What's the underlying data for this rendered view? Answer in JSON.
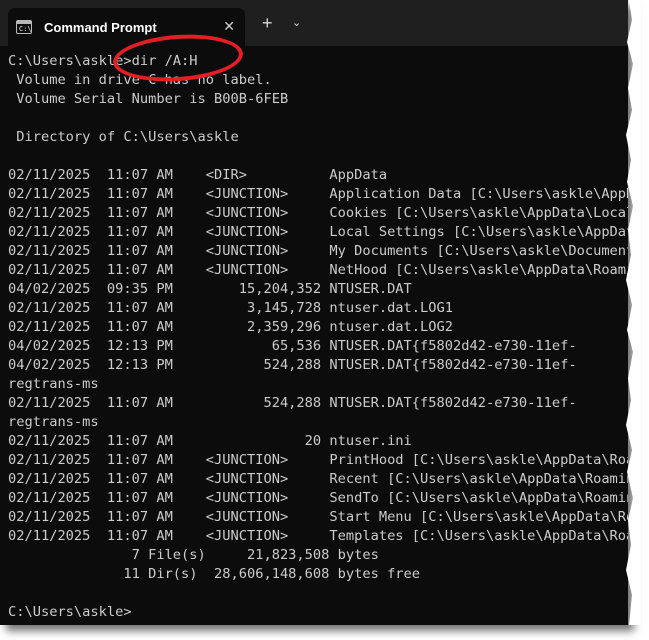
{
  "window": {
    "tab_title": "Command Prompt",
    "tab_icon_glyph": "C:\\",
    "close_glyph": "✕",
    "new_tab_glyph": "+",
    "dropdown_glyph": "⌄"
  },
  "terminal": {
    "lines": [
      "C:\\Users\\askle>dir /A:H",
      " Volume in drive C has no label.",
      " Volume Serial Number is B00B-6FEB",
      "",
      " Directory of C:\\Users\\askle",
      "",
      "02/11/2025  11:07 AM    <DIR>          AppData",
      "02/11/2025  11:07 AM    <JUNCTION>     Application Data [C:\\Users\\askle\\AppData\\Roaming]",
      "02/11/2025  11:07 AM    <JUNCTION>     Cookies [C:\\Users\\askle\\AppData\\Local\\Microsoft\\Windows\\INetCookies]",
      "02/11/2025  11:07 AM    <JUNCTION>     Local Settings [C:\\Users\\askle\\AppData\\Local]",
      "02/11/2025  11:07 AM    <JUNCTION>     My Documents [C:\\Users\\askle\\Documents]",
      "02/11/2025  11:07 AM    <JUNCTION>     NetHood [C:\\Users\\askle\\AppData\\Roaming\\Microsoft\\Windows\\Network Shortcuts]",
      "04/02/2025  09:35 PM        15,204,352 NTUSER.DAT",
      "02/11/2025  11:07 AM         3,145,728 ntuser.dat.LOG1",
      "02/11/2025  11:07 AM         2,359,296 ntuser.dat.LOG2",
      "04/02/2025  12:13 PM            65,536 NTUSER.DAT{f5802d42-e730-11ef-",
      "04/02/2025  12:13 PM           524,288 NTUSER.DAT{f5802d42-e730-11ef-",
      "regtrans-ms",
      "02/11/2025  11:07 AM           524,288 NTUSER.DAT{f5802d42-e730-11ef-",
      "regtrans-ms",
      "02/11/2025  11:07 AM                20 ntuser.ini",
      "02/11/2025  11:07 AM    <JUNCTION>     PrintHood [C:\\Users\\askle\\AppData\\Roaming\\Microsoft\\Windows\\Printer Shortcuts]",
      "02/11/2025  11:07 AM    <JUNCTION>     Recent [C:\\Users\\askle\\AppData\\Roaming\\Microsoft\\Windows\\Recent]",
      "02/11/2025  11:07 AM    <JUNCTION>     SendTo [C:\\Users\\askle\\AppData\\Roaming\\Microsoft\\Windows\\SendTo]",
      "02/11/2025  11:07 AM    <JUNCTION>     Start Menu [C:\\Users\\askle\\AppData\\Roaming\\Microsoft\\Windows\\Start Menu]",
      "02/11/2025  11:07 AM    <JUNCTION>     Templates [C:\\Users\\askle\\AppData\\Roaming\\Microsoft\\Windows\\Templates]",
      "               7 File(s)     21,823,508 bytes",
      "              11 Dir(s)  28,606,148,608 bytes free",
      "",
      "C:\\Users\\askle>"
    ]
  },
  "colors": {
    "terminal_bg": "#0c0c0c",
    "terminal_fg": "#cccccc",
    "titlebar_bg": "#1f1f1f",
    "annotation": "#e51e25"
  }
}
